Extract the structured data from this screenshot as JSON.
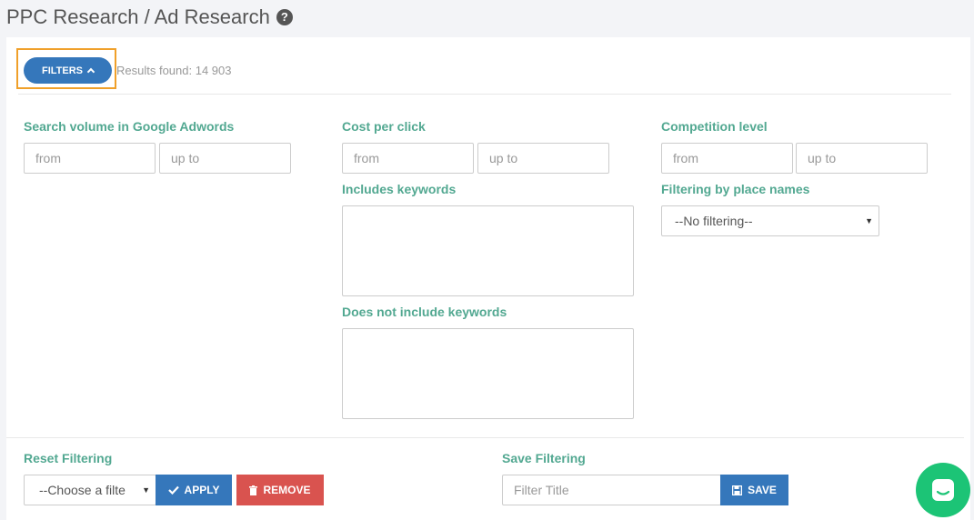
{
  "header": {
    "title": "PPC Research / Ad Research",
    "help_icon": "question-circle-icon"
  },
  "toolbar": {
    "filters_label": "FILTERS",
    "results_text": "Results found: 14 903"
  },
  "filters": {
    "search_volume": {
      "label": "Search volume in Google Adwords",
      "from_placeholder": "from",
      "to_placeholder": "up to"
    },
    "cpc": {
      "label": "Cost per click",
      "from_placeholder": "from",
      "to_placeholder": "up to"
    },
    "competition": {
      "label": "Competition level",
      "from_placeholder": "from",
      "to_placeholder": "up to"
    },
    "includes_keywords": {
      "label": "Includes keywords",
      "value": ""
    },
    "excludes_keywords": {
      "label": "Does not include keywords",
      "value": ""
    },
    "place_names": {
      "label": "Filtering by place names",
      "selected": "--No filtering--"
    }
  },
  "reset": {
    "label": "Reset Filtering",
    "select_value": "--Choose a filte",
    "apply_label": "APPLY",
    "remove_label": "REMOVE"
  },
  "save": {
    "label": "Save Filtering",
    "title_placeholder": "Filter Title",
    "save_label": "SAVE"
  },
  "colors": {
    "accent_blue": "#3577bb",
    "label_green": "#52a891",
    "danger_red": "#d9534f",
    "highlight_orange": "#f0a02a",
    "chat_green": "#1cc476"
  }
}
